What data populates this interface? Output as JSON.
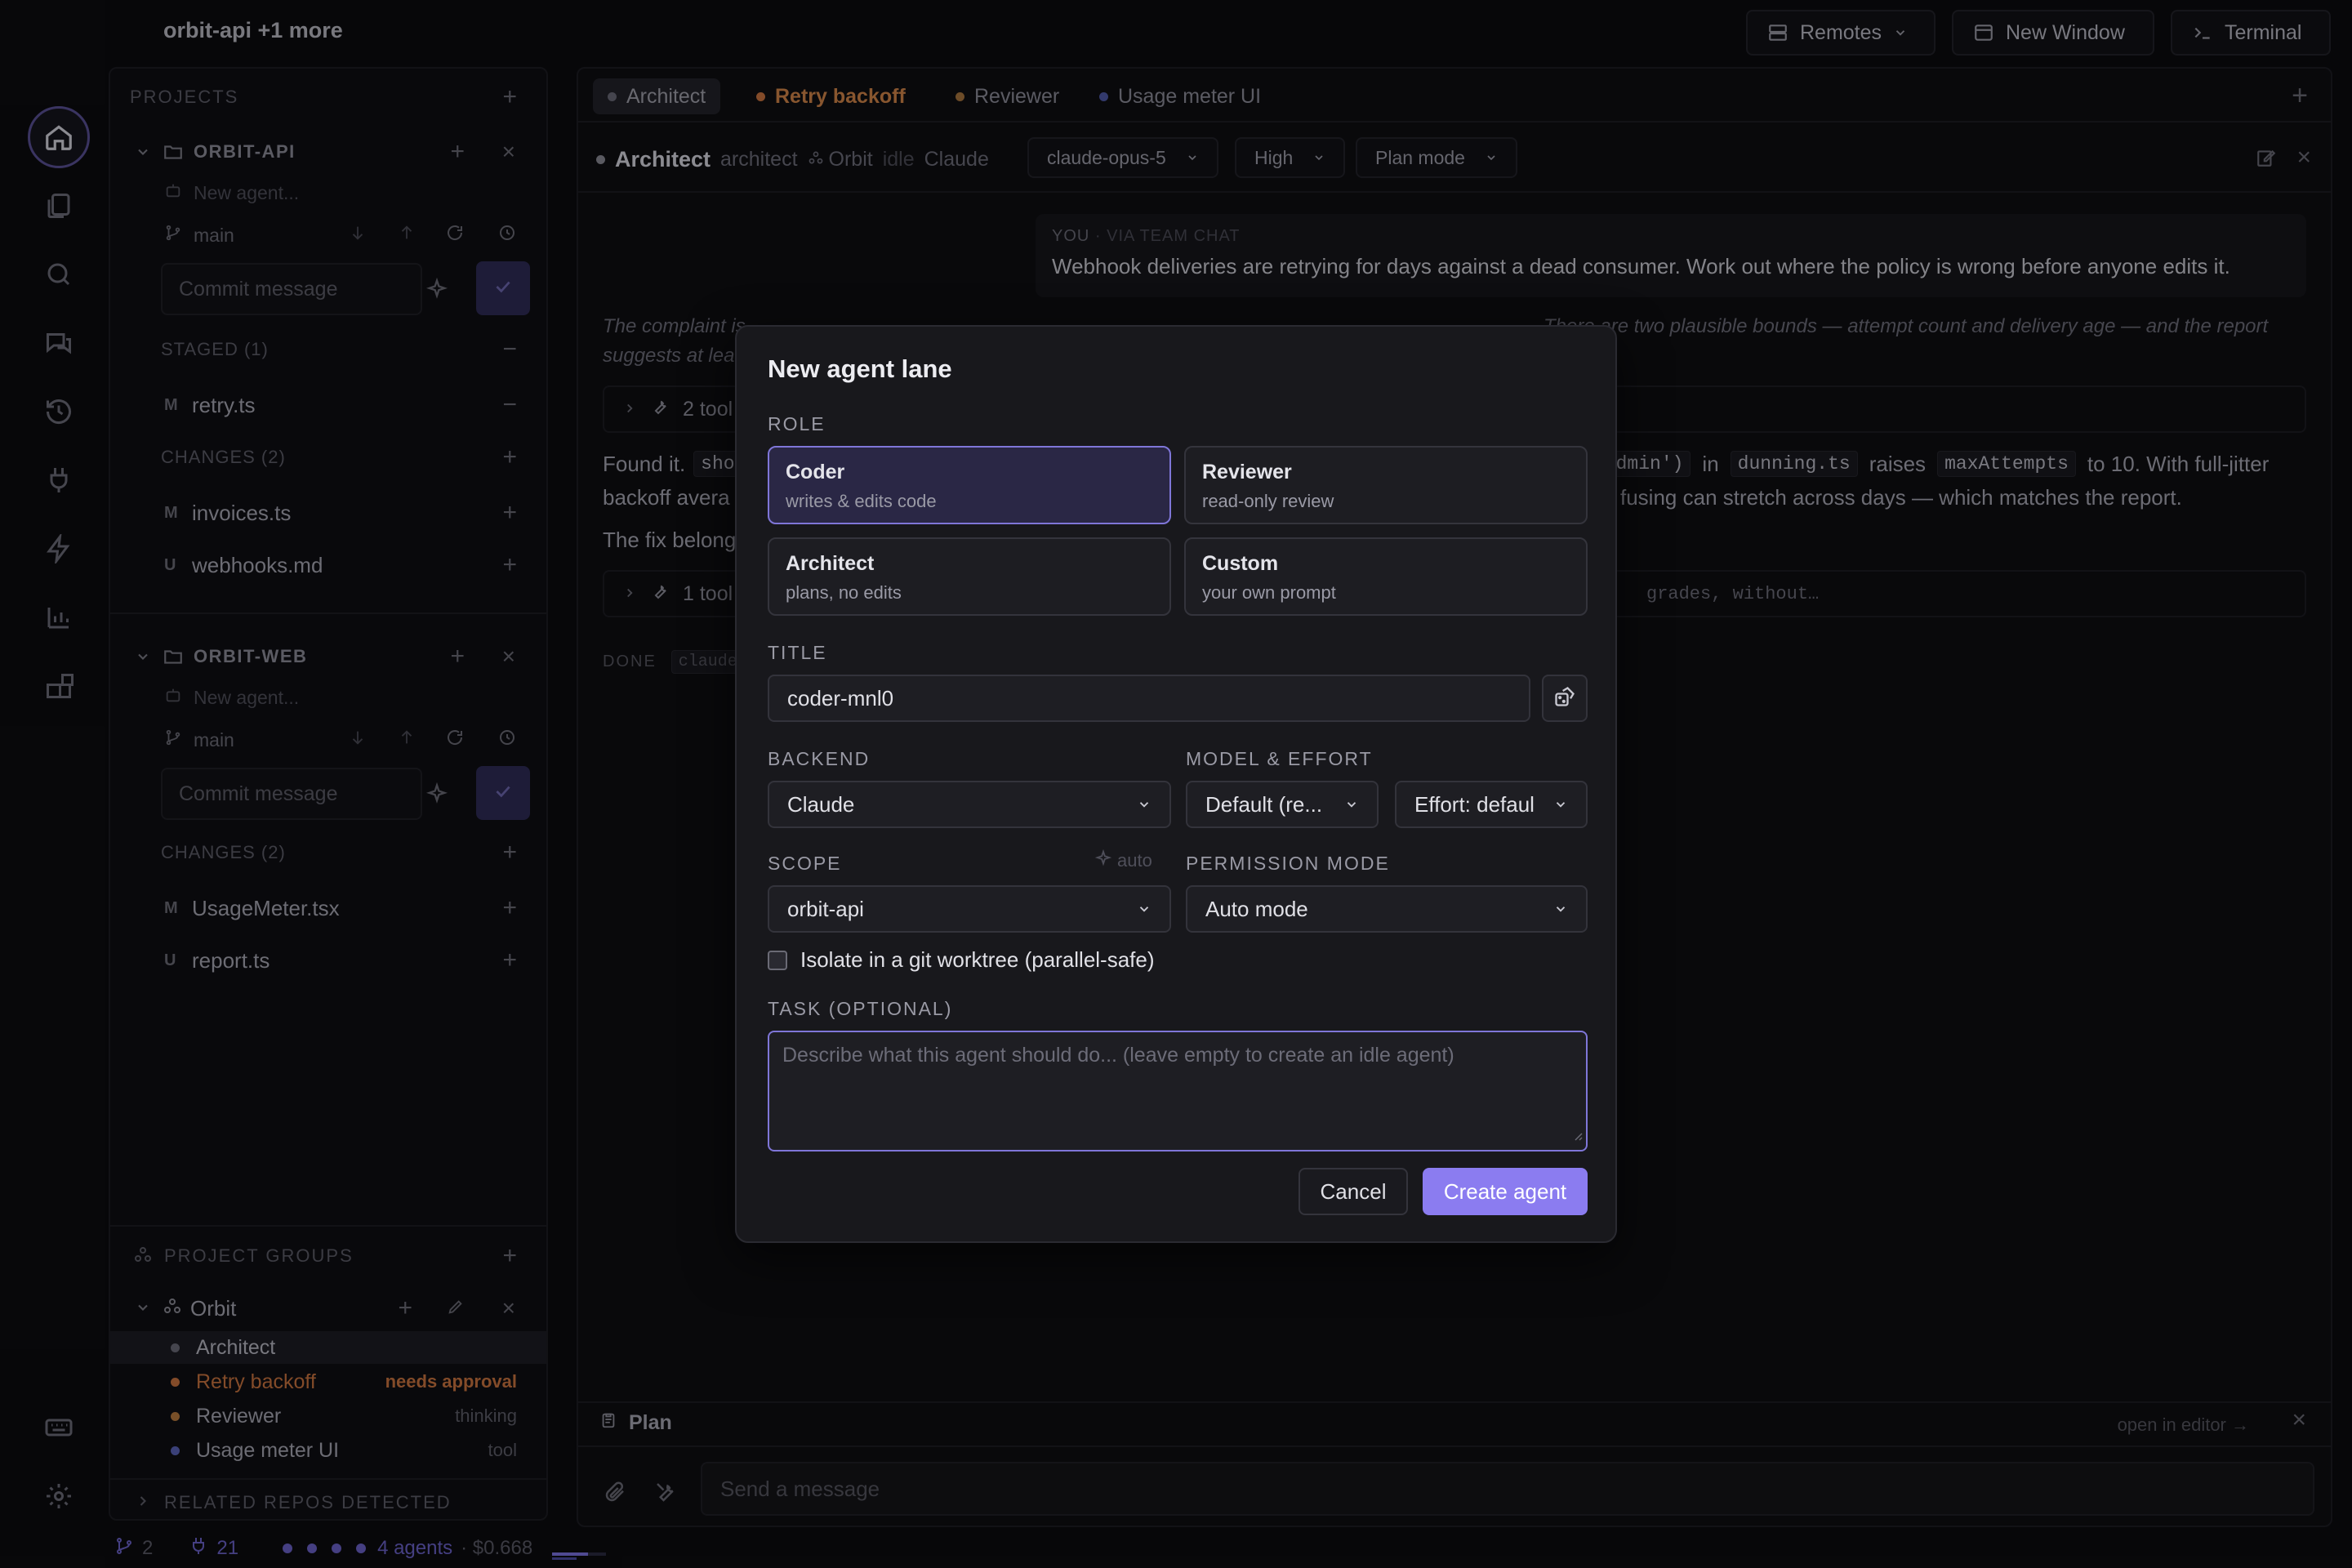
{
  "app": {
    "title": "orbit-api +1 more"
  },
  "topbar": {
    "remotes": "Remotes",
    "new_window": "New Window",
    "terminal": "Terminal"
  },
  "sidebar": {
    "projects_label": "PROJECTS",
    "repos": [
      {
        "name": "ORBIT-API",
        "new_agent": "New agent...",
        "branch": "main",
        "commit_placeholder": "Commit message",
        "staged_label": "STAGED (1)",
        "staged": [
          {
            "status": "M",
            "file": "retry.ts"
          }
        ],
        "changes_label": "CHANGES (2)",
        "changes": [
          {
            "status": "M",
            "file": "invoices.ts"
          },
          {
            "status": "U",
            "file": "webhooks.md"
          }
        ]
      },
      {
        "name": "ORBIT-WEB",
        "new_agent": "New agent...",
        "branch": "main",
        "commit_placeholder": "Commit message",
        "changes_label": "CHANGES (2)",
        "changes": [
          {
            "status": "M",
            "file": "UsageMeter.tsx"
          },
          {
            "status": "U",
            "file": "report.ts"
          }
        ]
      }
    ],
    "groups_label": "PROJECT GROUPS",
    "group_name": "Orbit",
    "group_agents": [
      {
        "name": "Architect",
        "status": "",
        "color": "#6b6b78"
      },
      {
        "name": "Retry backoff",
        "status": "needs approval",
        "color": "#c9743f"
      },
      {
        "name": "Reviewer",
        "status": "thinking",
        "color": "#b87a3e"
      },
      {
        "name": "Usage meter UI",
        "status": "tool",
        "color": "#5a63b8"
      }
    ],
    "related_label": "RELATED REPOS DETECTED"
  },
  "statusbar": {
    "branches": "2",
    "plugs": "21",
    "agents": "4 agents",
    "cost": "· $0.668"
  },
  "tabs": [
    {
      "label": "Architect",
      "color": "#6b6b78"
    },
    {
      "label": "Retry backoff",
      "color": "#c9743f"
    },
    {
      "label": "Reviewer",
      "color": "#a8763e"
    },
    {
      "label": "Usage meter UI",
      "color": "#4f5aa8"
    }
  ],
  "agent_header": {
    "name": "Architect",
    "role": "architect",
    "group": "Orbit",
    "state": "idle",
    "backend": "Claude",
    "model": "claude-opus-5",
    "effort": "High",
    "mode": "Plan mode"
  },
  "chat": {
    "you_label": "YOU",
    "via": "· VIA TEAM CHAT",
    "message": "Webhook deliveries are retrying for days against a dead consumer. Work out where the policy is wrong before anyone edits it.",
    "reply_italic_1": "The complaint is",
    "reply_italic_2": "suggests at lea",
    "reply_italic_right": "There are two plausible bounds — attempt count and delivery age — and the report",
    "tool1": "2 tool",
    "found_1": "Found it.",
    "code_sho": "sho",
    "code_admin": ".admin')",
    "in": "in",
    "code_dunning": "dunning.ts",
    "raises": "raises",
    "code_max": "maxAttempts",
    "to10": "to 10. With full-jitter",
    "backoff": "backoff avera",
    "fusing": "fusing can stretch across days — which matches the report.",
    "fix": "The fix belong",
    "tool2": "1 tool",
    "grades": "grades, without…",
    "done": "DONE",
    "claude_code": "claude"
  },
  "plan": {
    "label": "Plan",
    "open": "open in editor →"
  },
  "composer": {
    "placeholder": "Send a message"
  },
  "modal": {
    "title": "New agent lane",
    "role_label": "ROLE",
    "roles": [
      {
        "title": "Coder",
        "sub": "writes & edits code"
      },
      {
        "title": "Reviewer",
        "sub": "read-only review"
      },
      {
        "title": "Architect",
        "sub": "plans, no edits"
      },
      {
        "title": "Custom",
        "sub": "your own prompt"
      }
    ],
    "title_label": "TITLE",
    "title_value": "coder-mnl0",
    "backend_label": "BACKEND",
    "backend_value": "Claude",
    "model_label": "MODEL & EFFORT",
    "model_value": "Default (re...",
    "effort_value": "Effort: defaul",
    "scope_label": "SCOPE",
    "scope_auto": "auto",
    "scope_value": "orbit-api",
    "perm_label": "PERMISSION MODE",
    "perm_value": "Auto mode",
    "isolate": "Isolate in a git worktree (parallel-safe)",
    "task_label": "TASK (OPTIONAL)",
    "task_placeholder": "Describe what this agent should do... (leave empty to create an idle agent)",
    "cancel": "Cancel",
    "create": "Create agent"
  },
  "colors": {
    "accent": "#8b7cf0",
    "selected_card": "#2a2745"
  }
}
